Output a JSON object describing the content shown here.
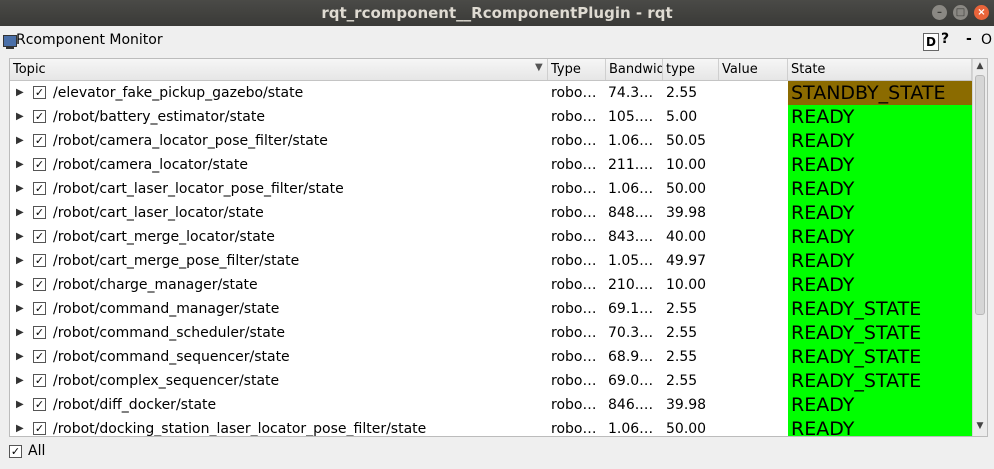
{
  "window": {
    "title": "rqt_rcomponent__RcomponentPlugin - rqt",
    "minimize": "–",
    "maximize": "□",
    "close": "×"
  },
  "plugin": {
    "title": "Rcomponent Monitor",
    "d_label": "D",
    "help_label": "?",
    "o_label": "-",
    "close_label": "O"
  },
  "columns": [
    "Topic",
    "Type",
    "Bandwidth",
    "type",
    "Value",
    "State"
  ],
  "colors": {
    "ready": "#00ff00",
    "standby": "#8b6b00"
  },
  "rows": [
    {
      "topic": "/elevator_fake_pickup_gazebo/state",
      "type": "robo…",
      "bandwidth": "74.3…",
      "rate": "2.55",
      "value": "",
      "state": "STANDBY_STATE",
      "color": "#8b6b00"
    },
    {
      "topic": "/robot/battery_estimator/state",
      "type": "robo…",
      "bandwidth": "105.…",
      "rate": "5.00",
      "value": "",
      "state": "READY",
      "color": "#00ff00"
    },
    {
      "topic": "/robot/camera_locator_pose_filter/state",
      "type": "robo…",
      "bandwidth": "1.06…",
      "rate": "50.05",
      "value": "",
      "state": "READY",
      "color": "#00ff00"
    },
    {
      "topic": "/robot/camera_locator/state",
      "type": "robo…",
      "bandwidth": "211.…",
      "rate": "10.00",
      "value": "",
      "state": "READY",
      "color": "#00ff00"
    },
    {
      "topic": "/robot/cart_laser_locator_pose_filter/state",
      "type": "robo…",
      "bandwidth": "1.06…",
      "rate": "50.00",
      "value": "",
      "state": "READY",
      "color": "#00ff00"
    },
    {
      "topic": "/robot/cart_laser_locator/state",
      "type": "robo…",
      "bandwidth": "848.…",
      "rate": "39.98",
      "value": "",
      "state": "READY",
      "color": "#00ff00"
    },
    {
      "topic": "/robot/cart_merge_locator/state",
      "type": "robo…",
      "bandwidth": "843.…",
      "rate": "40.00",
      "value": "",
      "state": "READY",
      "color": "#00ff00"
    },
    {
      "topic": "/robot/cart_merge_pose_filter/state",
      "type": "robo…",
      "bandwidth": "1.05…",
      "rate": "49.97",
      "value": "",
      "state": "READY",
      "color": "#00ff00"
    },
    {
      "topic": "/robot/charge_manager/state",
      "type": "robo…",
      "bandwidth": "210.…",
      "rate": "10.00",
      "value": "",
      "state": "READY",
      "color": "#00ff00"
    },
    {
      "topic": "/robot/command_manager/state",
      "type": "robo…",
      "bandwidth": "69.1…",
      "rate": "2.55",
      "value": "",
      "state": "READY_STATE",
      "color": "#00ff00"
    },
    {
      "topic": "/robot/command_scheduler/state",
      "type": "robo…",
      "bandwidth": "70.3…",
      "rate": "2.55",
      "value": "",
      "state": "READY_STATE",
      "color": "#00ff00"
    },
    {
      "topic": "/robot/command_sequencer/state",
      "type": "robo…",
      "bandwidth": "68.9…",
      "rate": "2.55",
      "value": "",
      "state": "READY_STATE",
      "color": "#00ff00"
    },
    {
      "topic": "/robot/complex_sequencer/state",
      "type": "robo…",
      "bandwidth": "69.0…",
      "rate": "2.55",
      "value": "",
      "state": "READY_STATE",
      "color": "#00ff00"
    },
    {
      "topic": "/robot/diff_docker/state",
      "type": "robo…",
      "bandwidth": "846.…",
      "rate": "39.98",
      "value": "",
      "state": "READY",
      "color": "#00ff00"
    },
    {
      "topic": "/robot/docking_station_laser_locator_pose_filter/state",
      "type": "robo…",
      "bandwidth": "1.06…",
      "rate": "50.00",
      "value": "",
      "state": "READY",
      "color": "#00ff00"
    }
  ],
  "footer": {
    "all_label": "All",
    "check_mark": "✓"
  }
}
